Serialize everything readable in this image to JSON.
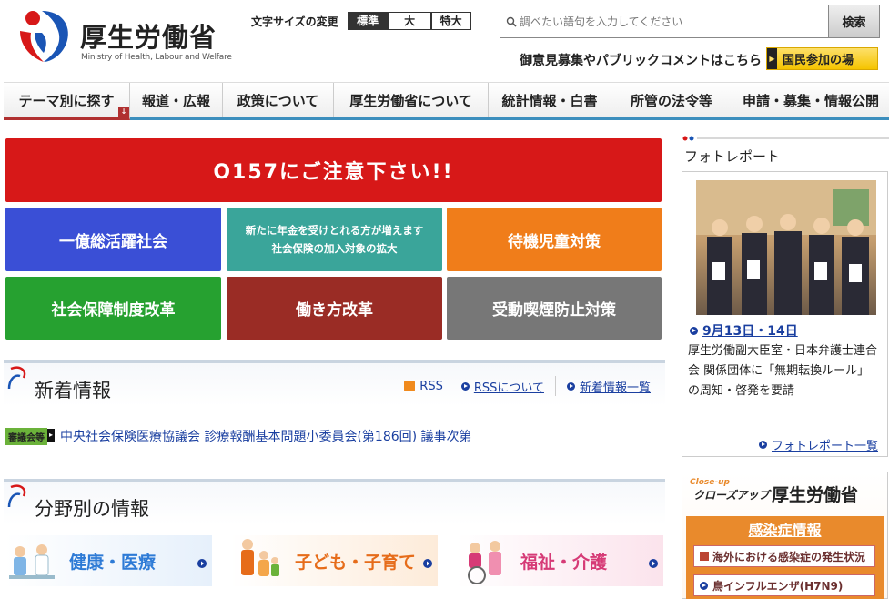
{
  "header": {
    "logo_title": "厚生労働省",
    "logo_subtitle": "Ministry of Health, Labour and Welfare",
    "fontsize_label": "文字サイズの変更",
    "fontsize_options": [
      "標準",
      "大",
      "特大"
    ],
    "search_placeholder": "調べたい語句を入力してください",
    "search_button": "検索",
    "opinion_text": "御意見募集やパブリックコメントはこちら",
    "participate_button": "国民参加の場"
  },
  "nav": [
    "テーマ別に探す",
    "報道・広報",
    "政策について",
    "厚生労働省について",
    "統計情報・白書",
    "所管の法令等",
    "申請・募集・情報公開"
  ],
  "banners": {
    "main": "O157にご注意下さい!!",
    "b1": "一億総活躍社会",
    "b2_line1": "新たに年金を受けとれる方が増えます",
    "b2_line2": "社会保険の加入対象の拡大",
    "b3": "待機児童対策",
    "b4": "社会保障制度改革",
    "b5": "働き方改革",
    "b6": "受動喫煙防止対策"
  },
  "news": {
    "title": "新着情報",
    "rss": "RSS",
    "rss_about": "RSSについて",
    "list_link": "新着情報一覧",
    "item_tag": "審議会等",
    "item_text": "中央社会保険医療協議会 診療報酬基本問題小委員会(第186回) 議事次第"
  },
  "fields": {
    "title": "分野別の情報",
    "items": [
      "健康・医療",
      "子ども・子育て",
      "福祉・介護"
    ]
  },
  "photo_report": {
    "title": "フォトレポート",
    "date": "9月13日・14日",
    "text": "厚生労働副大臣室・日本弁護士連合会 関係団体に「無期転換ルール」の周知・啓発を要請",
    "list_link": "フォトレポート一覧"
  },
  "closeup": {
    "small": "Close-up",
    "sub": "クローズアップ",
    "title": "厚生労働省",
    "head": "感染症情報",
    "items": [
      "海外における感染症の発生状況",
      "鳥インフルエンザ(H7N9)"
    ]
  },
  "colors": {
    "accent_blue": "#3c8ebd",
    "link": "#1a3fa0",
    "main_red": "#d71818"
  }
}
